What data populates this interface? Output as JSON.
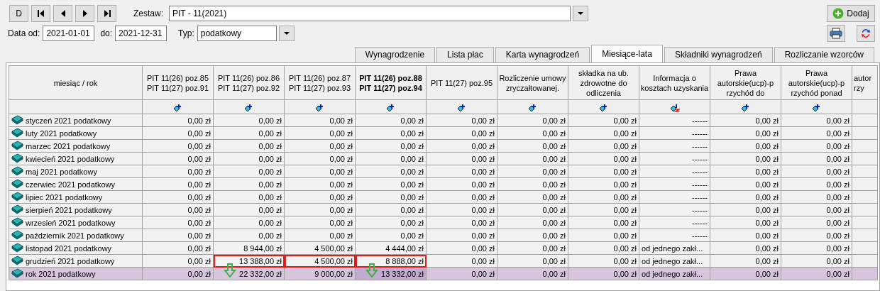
{
  "nav_buttons": [
    {
      "kind": "new",
      "label": "D"
    },
    {
      "kind": "first"
    },
    {
      "kind": "prev"
    },
    {
      "kind": "next"
    },
    {
      "kind": "last"
    }
  ],
  "zestaw": {
    "label": "Zestaw:",
    "value": "PIT - 11(2021)"
  },
  "add_button": {
    "label": "Dodaj"
  },
  "date_from": {
    "label": "Data od:",
    "value": "2021-01-01"
  },
  "date_to": {
    "label": "do:",
    "value": "2021-12-31"
  },
  "type": {
    "label": "Typ:",
    "value": "podatkowy"
  },
  "tabs": [
    {
      "label": "Wynagrodzenie",
      "selected": false
    },
    {
      "label": "Lista płac",
      "selected": false
    },
    {
      "label": "Karta wynagrodzeń",
      "selected": false
    },
    {
      "label": "Miesiące-lata",
      "selected": true
    },
    {
      "label": "Składniki wynagrodzeń",
      "selected": false
    },
    {
      "label": "Rozliczanie wzorców",
      "selected": false
    }
  ],
  "table": {
    "columns": [
      {
        "label": "miesiąc / rok",
        "bold": false,
        "kind": "plain"
      },
      {
        "label": "PIT 11(26) poz.85 PIT 11(27) poz.91",
        "bold": false,
        "kind": "add"
      },
      {
        "label": "PIT 11(26) poz.86 PIT 11(27) poz.92",
        "bold": false,
        "kind": "add"
      },
      {
        "label": "PIT 11(26) poz.87 PIT 11(27) poz.93",
        "bold": false,
        "kind": "add"
      },
      {
        "label": "PIT 11(26) poz.88 PIT 11(27) poz.94",
        "bold": true,
        "kind": "add"
      },
      {
        "label": "PIT 11(27) poz.95",
        "bold": false,
        "kind": "add"
      },
      {
        "label": "Rozliczenie umowy zryczałtowanej.",
        "bold": false,
        "kind": "add"
      },
      {
        "label": "składka na ub. zdrowotne do odliczenia",
        "bold": false,
        "kind": "add"
      },
      {
        "label": "Informacja o kosztach uzyskania",
        "bold": false,
        "kind": "switch"
      },
      {
        "label": "Prawa autorskie(ucp)-p rzychód do",
        "bold": false,
        "kind": "add"
      },
      {
        "label": "Prawa autorskie(ucp)-p rzychód ponad",
        "bold": false,
        "kind": "add"
      },
      {
        "label": "autor rzy",
        "bold": false,
        "kind": "plain"
      }
    ],
    "rows": [
      {
        "kind": "month",
        "cells": [
          "styczeń 2021 podatkowy",
          "0,00 zł",
          "0,00 zł",
          "0,00 zł",
          "0,00 zł",
          "0,00 zł",
          "0,00 zł",
          "0,00 zł",
          "------",
          "0,00 zł",
          "0,00 zł"
        ]
      },
      {
        "kind": "month",
        "cells": [
          "luty 2021 podatkowy",
          "0,00 zł",
          "0,00 zł",
          "0,00 zł",
          "0,00 zł",
          "0,00 zł",
          "0,00 zł",
          "0,00 zł",
          "------",
          "0,00 zł",
          "0,00 zł"
        ]
      },
      {
        "kind": "month",
        "cells": [
          "marzec 2021 podatkowy",
          "0,00 zł",
          "0,00 zł",
          "0,00 zł",
          "0,00 zł",
          "0,00 zł",
          "0,00 zł",
          "0,00 zł",
          "------",
          "0,00 zł",
          "0,00 zł"
        ]
      },
      {
        "kind": "month",
        "cells": [
          "kwiecień 2021 podatkowy",
          "0,00 zł",
          "0,00 zł",
          "0,00 zł",
          "0,00 zł",
          "0,00 zł",
          "0,00 zł",
          "0,00 zł",
          "------",
          "0,00 zł",
          "0,00 zł"
        ]
      },
      {
        "kind": "month",
        "cells": [
          "maj 2021 podatkowy",
          "0,00 zł",
          "0,00 zł",
          "0,00 zł",
          "0,00 zł",
          "0,00 zł",
          "0,00 zł",
          "0,00 zł",
          "------",
          "0,00 zł",
          "0,00 zł"
        ]
      },
      {
        "kind": "month",
        "cells": [
          "czerwiec 2021 podatkowy",
          "0,00 zł",
          "0,00 zł",
          "0,00 zł",
          "0,00 zł",
          "0,00 zł",
          "0,00 zł",
          "0,00 zł",
          "------",
          "0,00 zł",
          "0,00 zł"
        ]
      },
      {
        "kind": "month",
        "cells": [
          "lipiec 2021 podatkowy",
          "0,00 zł",
          "0,00 zł",
          "0,00 zł",
          "0,00 zł",
          "0,00 zł",
          "0,00 zł",
          "0,00 zł",
          "------",
          "0,00 zł",
          "0,00 zł"
        ]
      },
      {
        "kind": "month",
        "cells": [
          "sierpień 2021 podatkowy",
          "0,00 zł",
          "0,00 zł",
          "0,00 zł",
          "0,00 zł",
          "0,00 zł",
          "0,00 zł",
          "0,00 zł",
          "------",
          "0,00 zł",
          "0,00 zł"
        ]
      },
      {
        "kind": "month",
        "cells": [
          "wrzesień 2021 podatkowy",
          "0,00 zł",
          "0,00 zł",
          "0,00 zł",
          "0,00 zł",
          "0,00 zł",
          "0,00 zł",
          "0,00 zł",
          "------",
          "0,00 zł",
          "0,00 zł"
        ]
      },
      {
        "kind": "month",
        "cells": [
          "październik 2021 podatkowy",
          "0,00 zł",
          "0,00 zł",
          "0,00 zł",
          "0,00 zł",
          "0,00 zł",
          "0,00 zł",
          "0,00 zł",
          "------",
          "0,00 zł",
          "0,00 zł"
        ]
      },
      {
        "kind": "month",
        "cells": [
          "listopad 2021 podatkowy",
          "0,00 zł",
          "8 944,00 zł",
          "4 500,00 zł",
          "4 444,00 zł",
          "0,00 zł",
          "0,00 zł",
          "0,00 zł",
          "od jednego zakł...",
          "0,00 zł",
          "0,00 zł"
        ]
      },
      {
        "kind": "month",
        "cells": [
          "grudzień 2021 podatkowy",
          "0,00 zł",
          "13 388,00 zł",
          "4 500,00 zł",
          "8 888,00 zł",
          "0,00 zł",
          "0,00 zł",
          "0,00 zł",
          "od jednego zakł...",
          "0,00 zł",
          "0,00 zł"
        ],
        "flagged_cells": [
          false,
          false,
          true,
          true,
          true,
          false,
          false,
          false,
          false,
          false,
          false
        ]
      },
      {
        "kind": "total",
        "cells": [
          "rok 2021 podatkowy",
          "0,00 zł",
          "22 332,00 zł",
          "9 000,00 zł",
          "13 332,00 zł",
          "0,00 zł",
          "0,00 zł",
          "0,00 zł",
          "od jednego zakł...",
          "0,00 zł",
          "0,00 zł"
        ],
        "arrow_cells": [
          false,
          false,
          true,
          false,
          true,
          false,
          false,
          false,
          false,
          false,
          false
        ],
        "selected_cells": [
          false,
          false,
          false,
          false,
          true,
          false,
          false,
          false,
          false,
          false,
          false
        ]
      }
    ]
  }
}
